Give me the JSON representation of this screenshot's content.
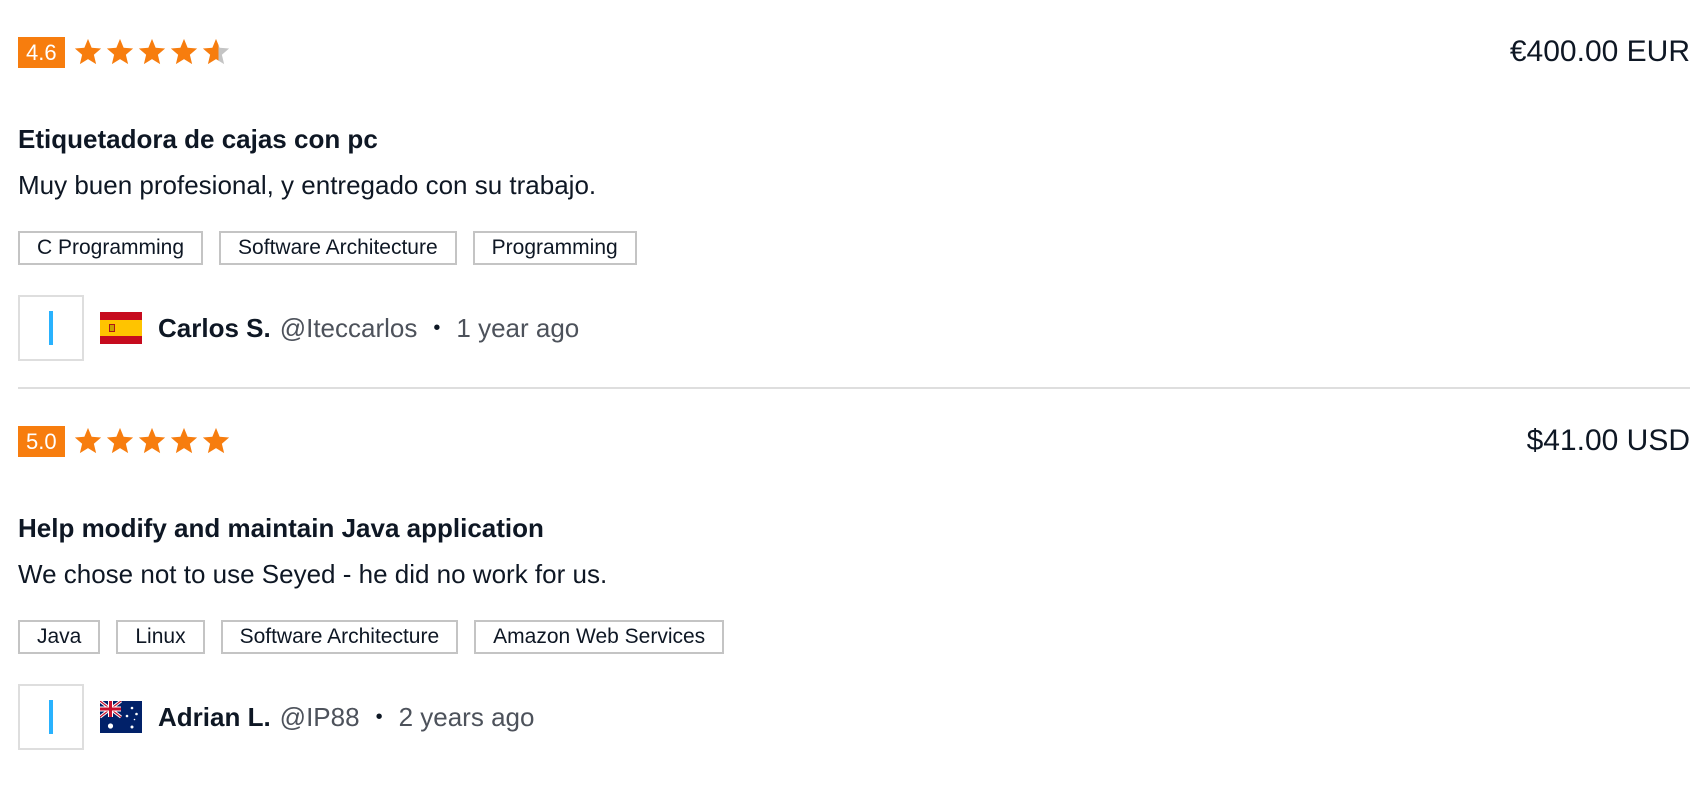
{
  "colors": {
    "accent": "#f77d0e",
    "star_empty": "#c4c4c4",
    "avatar_bar": "#29b2fe",
    "divider": "#dedede"
  },
  "reviews": [
    {
      "rating": "4.6",
      "stars": 4.6,
      "amount": "€400.00 EUR",
      "title": "Etiquetadora de cajas con pc",
      "comment": "Muy buen profesional, y entregado con su trabajo.",
      "tags": [
        "C Programming",
        "Software Architecture",
        "Programming"
      ],
      "reviewer_name": "Carlos S.",
      "reviewer_handle": "@Iteccarlos",
      "separator": "•",
      "time": "1 year ago",
      "flag": "spain-flag-icon"
    },
    {
      "rating": "5.0",
      "stars": 5,
      "amount": "$41.00 USD",
      "title": "Help modify and maintain Java application",
      "comment": "We chose not to use Seyed - he did no work for us.",
      "tags": [
        "Java",
        "Linux",
        "Software Architecture",
        "Amazon Web Services"
      ],
      "reviewer_name": "Adrian L.",
      "reviewer_handle": "@IP88",
      "separator": "•",
      "time": "2 years ago",
      "flag": "australia-flag-icon"
    }
  ]
}
